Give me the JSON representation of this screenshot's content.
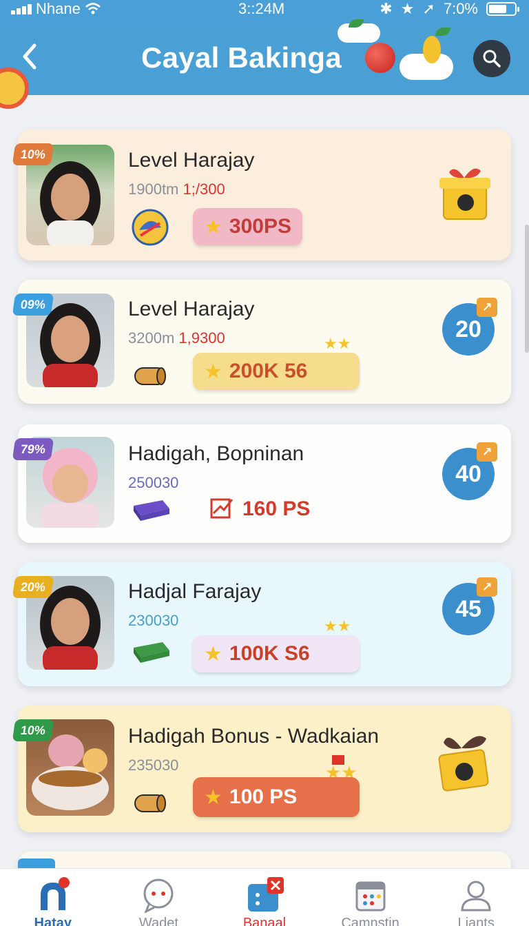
{
  "status_bar": {
    "carrier": "Nhane",
    "time": "3::24M",
    "battery": "7:0%"
  },
  "header": {
    "title": "Cayal Bakinga"
  },
  "cards": [
    {
      "percent": "10%",
      "percent_color": "#e07a3a",
      "bg": "#fbeedd",
      "title": "Level Harajay",
      "sub_a": "1900tm",
      "sub_b": "1;/300",
      "points": "300PS",
      "points_bg": "#f1b9c6",
      "points_color": "#c43b3b",
      "right": "gift"
    },
    {
      "percent": "09%",
      "percent_color": "#3a9fdc",
      "bg": "#fdfbef",
      "title": "Level Harajay",
      "sub_a": "3200m",
      "sub_b": "1,9300",
      "points": "200K 56",
      "points_bg": "#f6dd8e",
      "points_color": "#c9502a",
      "right": "20"
    },
    {
      "percent": "79%",
      "percent_color": "#7b5bbf",
      "bg": "#fefefd",
      "title": "Hadigah, Bopninan",
      "sub_a": "250030",
      "sub_b": "",
      "points": "160 PS",
      "points_bg": "transparent",
      "points_color": "#d33c2c",
      "right": "40"
    },
    {
      "percent": "20%",
      "percent_color": "#e8b021",
      "bg": "#e8f7fb",
      "title": "Hadjal Farajay",
      "sub_a": "230030",
      "sub_b": "",
      "points": "100K S6",
      "points_bg": "#f1e6f5",
      "points_color": "#c9402a",
      "right": "45"
    },
    {
      "percent": "10%",
      "percent_color": "#2f9a4a",
      "bg": "#fcf0c9",
      "title": "Hadigah Bonus - Wadkaian",
      "sub_a": "235030",
      "sub_b": "",
      "points": "100 PS",
      "points_bg": "#e5704a",
      "points_color": "#ffffff",
      "right": "gift"
    }
  ],
  "nav": [
    {
      "label": "Hatay",
      "icon": "magnet-icon"
    },
    {
      "label": "Wadet",
      "icon": "chat-icon"
    },
    {
      "label": "Banaal",
      "icon": "calculator-icon"
    },
    {
      "label": "Camnstin",
      "icon": "calendar-icon"
    },
    {
      "label": "Ljants",
      "icon": "user-icon"
    }
  ]
}
